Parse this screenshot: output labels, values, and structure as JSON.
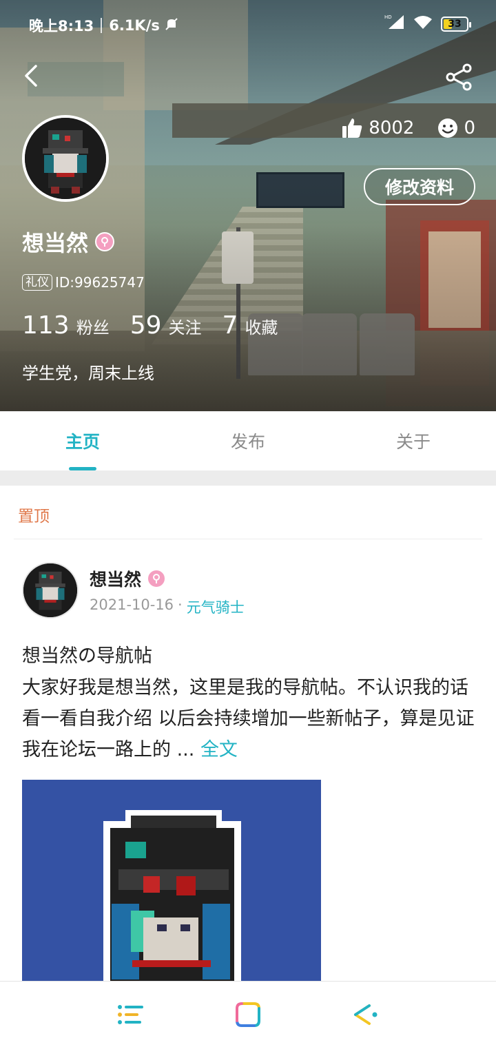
{
  "status_bar": {
    "time": "晚上8:13",
    "net_speed": "6.1K/s",
    "battery": "33"
  },
  "header": {
    "likes": "8002",
    "comments": "0",
    "edit_label": "修改资料"
  },
  "profile": {
    "name": "想当然",
    "tag": "礼仪",
    "id_text": "ID:99625747",
    "fans_count": "113",
    "fans_label": "粉丝",
    "follow_count": "59",
    "follow_label": "关注",
    "fav_count": "7",
    "fav_label": "收藏",
    "bio": "学生党，周末上线"
  },
  "tabs": [
    {
      "label": "主页",
      "active": true
    },
    {
      "label": "发布",
      "active": false
    },
    {
      "label": "关于",
      "active": false
    }
  ],
  "pinned_label": "置顶",
  "post": {
    "author": "想当然",
    "date": "2021-10-16",
    "dot": "·",
    "section": "元气骑士",
    "title": "想当然の导航帖",
    "body": "大家好我是想当然，这里是我的导航帖。不认识我的话 看一看自我介绍 以后会持续增加一些新帖子，算是见证我在论坛一路上的 ...",
    "more": "全文"
  },
  "colors": {
    "accent": "#22b3c4",
    "pinned": "#e0784a",
    "image_bg": "#3452a4"
  },
  "bottom_nav": [
    {
      "icon": "list-icon"
    },
    {
      "icon": "square-icon"
    },
    {
      "icon": "share-arrow-icon"
    }
  ]
}
